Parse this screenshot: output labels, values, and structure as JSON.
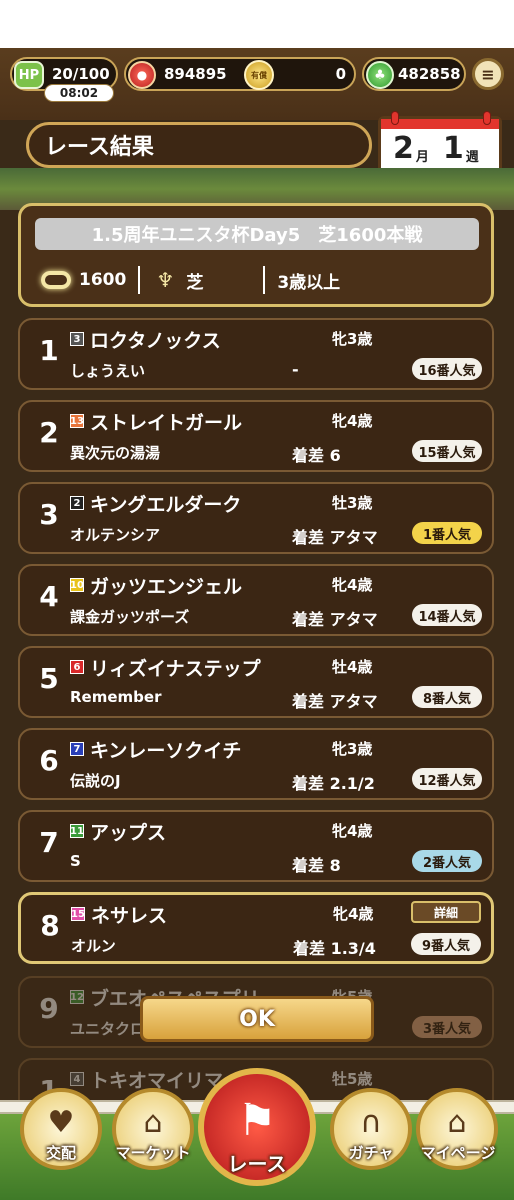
{
  "status": {
    "hp": "20/100",
    "hp_timer": "08:02",
    "hp_icon": "HP",
    "coins": "894895",
    "paid_icon": "有償",
    "paid": "0",
    "green": "482858"
  },
  "header": {
    "title": "レース結果",
    "calendar": {
      "month": "2",
      "month_unit": "月",
      "week": "1",
      "week_unit": "週"
    }
  },
  "race": {
    "name": "1.5周年ユニスタ杯Day5　芝1600本戦",
    "distance": "1600",
    "surface": "芝",
    "condition": "3歳以上"
  },
  "results": [
    {
      "rank": "1",
      "gate": "3",
      "gate_color": "#555555",
      "horse": "ロクタノックス",
      "sex_age": "牝3歳",
      "jockey": "しょうえい",
      "margin": "-",
      "popularity": "16番人気",
      "pop_style": "white"
    },
    {
      "rank": "2",
      "gate": "13",
      "gate_color": "#e8743a",
      "horse": "ストレイトガール",
      "sex_age": "牝4歳",
      "jockey": "異次元の湯湯",
      "margin": "着差 6",
      "popularity": "15番人気",
      "pop_style": "white"
    },
    {
      "rank": "3",
      "gate": "2",
      "gate_color": "#222222",
      "horse": "キングエルダーク",
      "sex_age": "牡3歳",
      "jockey": "オルテンシア",
      "margin": "着差 アタマ",
      "popularity": "1番人気",
      "pop_style": "gold"
    },
    {
      "rank": "4",
      "gate": "10",
      "gate_color": "#e8c21a",
      "horse": "ガッツエンジェル",
      "sex_age": "牝4歳",
      "jockey": "課金ガッツポーズ",
      "margin": "着差 アタマ",
      "popularity": "14番人気",
      "pop_style": "white"
    },
    {
      "rank": "5",
      "gate": "6",
      "gate_color": "#d8282a",
      "horse": "リィズイナステップ",
      "sex_age": "牡4歳",
      "jockey": "Remember",
      "margin": "着差 アタマ",
      "popularity": "8番人気",
      "pop_style": "white"
    },
    {
      "rank": "6",
      "gate": "7",
      "gate_color": "#2a3fb8",
      "horse": "キンレーソクイチ",
      "sex_age": "牝3歳",
      "jockey": "伝説のJ",
      "margin": "着差 2.1/2",
      "popularity": "12番人気",
      "pop_style": "white"
    },
    {
      "rank": "7",
      "gate": "11",
      "gate_color": "#3a9a3a",
      "horse": "アップス",
      "sex_age": "牝4歳",
      "jockey": "S",
      "margin": "着差 8",
      "popularity": "2番人気",
      "pop_style": "blue"
    },
    {
      "rank": "8",
      "gate": "15",
      "gate_color": "#e04fa8",
      "horse": "ネサレス",
      "sex_age": "牝4歳",
      "jockey": "オルン",
      "margin": "着差 1.3/4",
      "popularity": "9番人気",
      "pop_style": "white",
      "detail": "詳細"
    },
    {
      "rank": "9",
      "gate": "12",
      "gate_color": "#3a9a3a",
      "horse": "ブエオペスペスプリ",
      "sex_age": "牝5歳",
      "jockey": "ユニタクロ",
      "margin": "",
      "popularity": "3番人気",
      "pop_style": "bronze"
    },
    {
      "rank": "1",
      "gate": "4",
      "gate_color": "#555555",
      "horse": "トキオマイリマ",
      "sex_age": "牡5歳",
      "jockey": "",
      "margin": "",
      "popularity": "",
      "pop_style": "white"
    }
  ],
  "ok_label": "OK",
  "nav": {
    "breeding": "交配",
    "market": "マーケット",
    "race": "レース",
    "gacha": "ガチャ",
    "mypage": "マイページ"
  }
}
